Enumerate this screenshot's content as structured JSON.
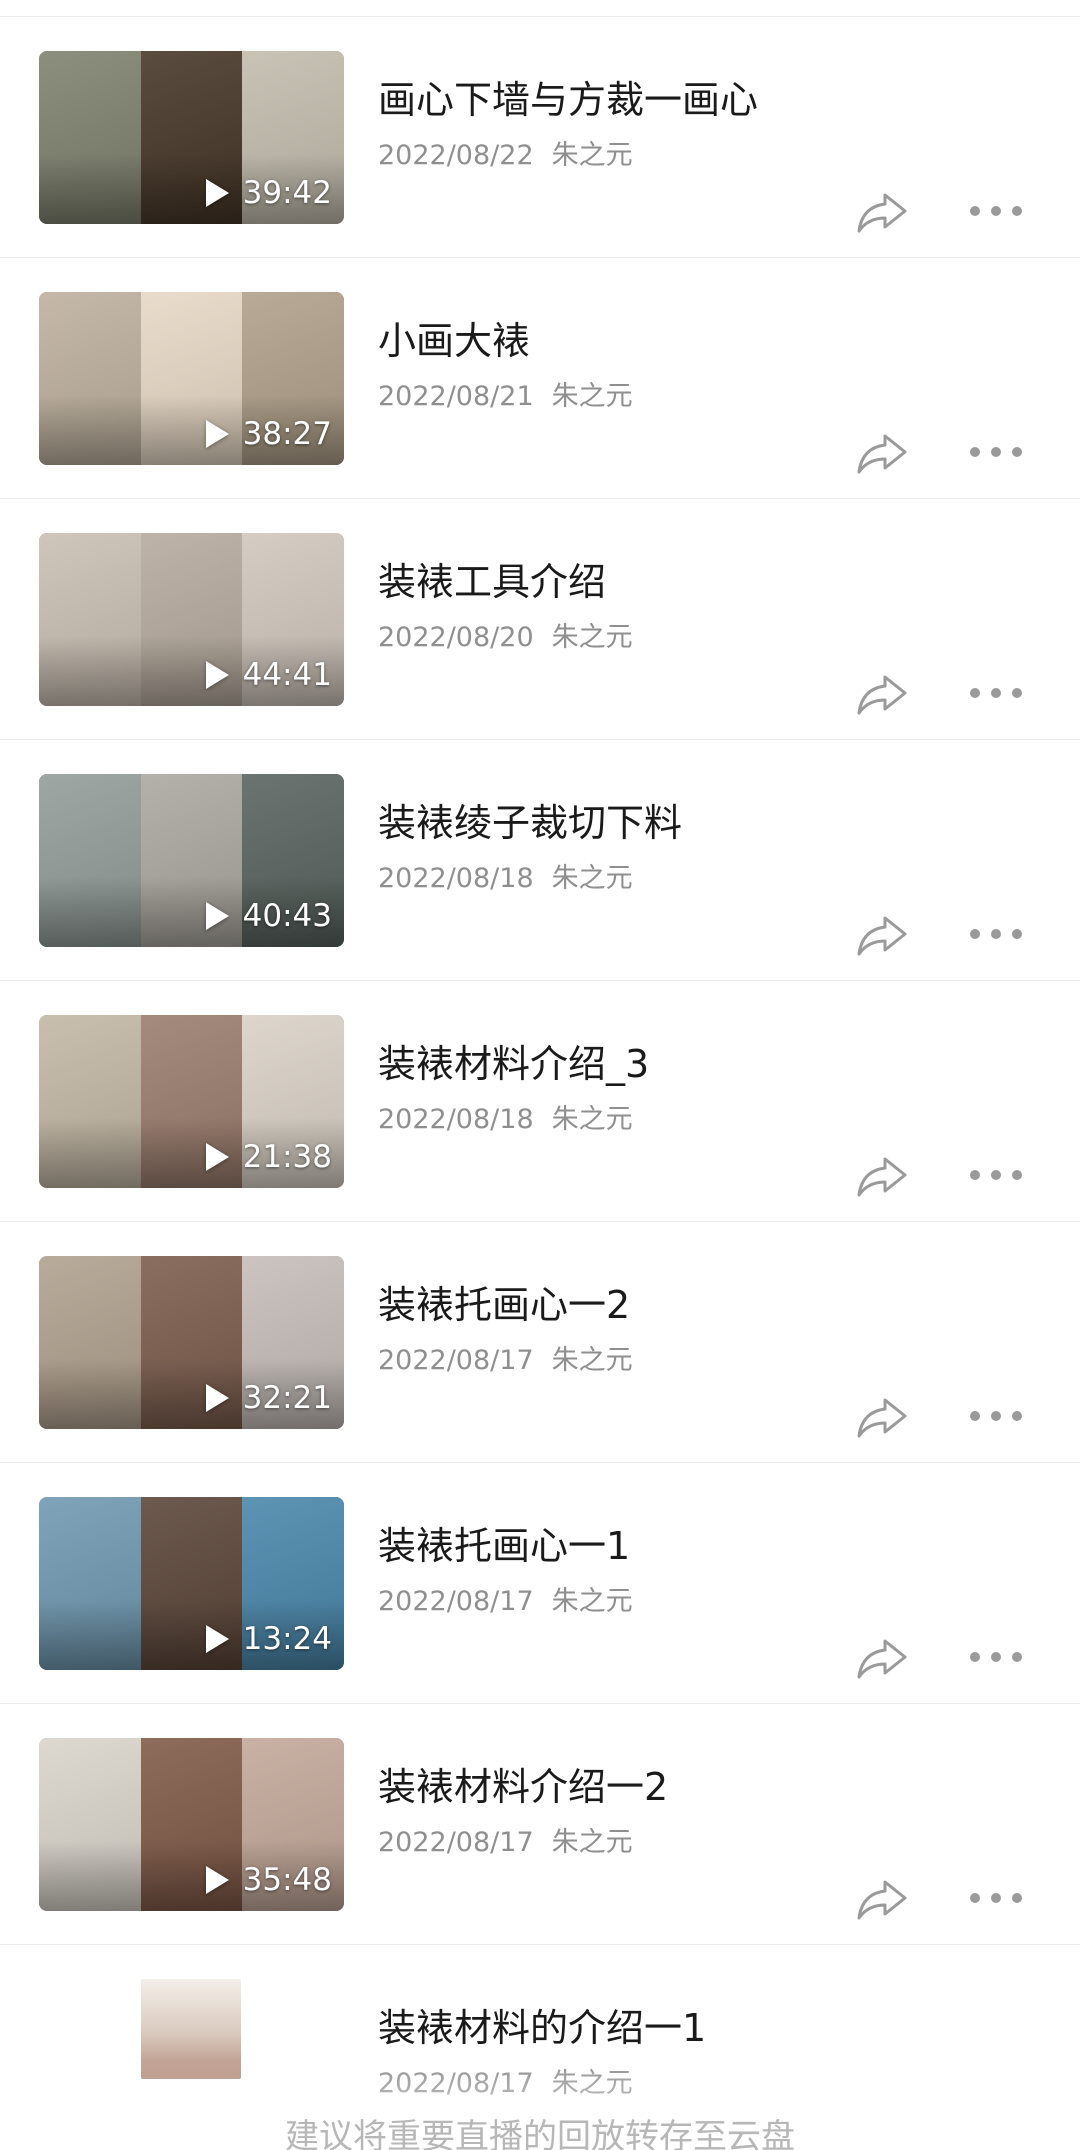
{
  "videos": [
    {
      "title": "画心下墙与方裁一画心",
      "date": "2022/08/22",
      "author": "朱之元",
      "duration": "39:42",
      "frames": [
        "#8c8f7e",
        "#5a4c3f",
        "#c9c3b6"
      ]
    },
    {
      "title": "小画大裱",
      "date": "2022/08/21",
      "author": "朱之元",
      "duration": "38:27",
      "frames": [
        "#c4b9a8",
        "#e9dccb",
        "#b8aa96"
      ]
    },
    {
      "title": "装裱工具介绍",
      "date": "2022/08/20",
      "author": "朱之元",
      "duration": "44:41",
      "frames": [
        "#cfc6bb",
        "#bdb3a8",
        "#d5ccc3"
      ]
    },
    {
      "title": "装裱绫子裁切下料",
      "date": "2022/08/18",
      "author": "朱之元",
      "duration": "40:43",
      "frames": [
        "#9ea7a4",
        "#b4b1aa",
        "#6b7470"
      ]
    },
    {
      "title": "装裱材料介绍_3",
      "date": "2022/08/18",
      "author": "朱之元",
      "duration": "21:38",
      "frames": [
        "#c9bfae",
        "#a58b7d",
        "#ddd6cc"
      ]
    },
    {
      "title": "装裱托画心一2",
      "date": "2022/08/17",
      "author": "朱之元",
      "duration": "32:21",
      "frames": [
        "#b9ab9a",
        "#8a6f61",
        "#cbc4c0"
      ]
    },
    {
      "title": "装裱托画心一1",
      "date": "2022/08/17",
      "author": "朱之元",
      "duration": "13:24",
      "frames": [
        "#7fa3b8",
        "#6d5a4f",
        "#5d93b3"
      ]
    },
    {
      "title": "装裱材料介绍一2",
      "date": "2022/08/17",
      "author": "朱之元",
      "duration": "35:48",
      "frames": [
        "#ddd8d0",
        "#8e6c5c",
        "#c9b1a4"
      ]
    }
  ],
  "partial_video": {
    "title": "装裱材料的介绍一1",
    "date": "2022/08/17",
    "author": "朱之元"
  },
  "footer_hint": "建议将重要直播的回放转存至云盘",
  "colors": {
    "title": "#1a1a1a",
    "meta": "#8f8f8f",
    "icon": "#9a9a9a",
    "divider": "#ececec",
    "hint": "#b7b7b7"
  }
}
